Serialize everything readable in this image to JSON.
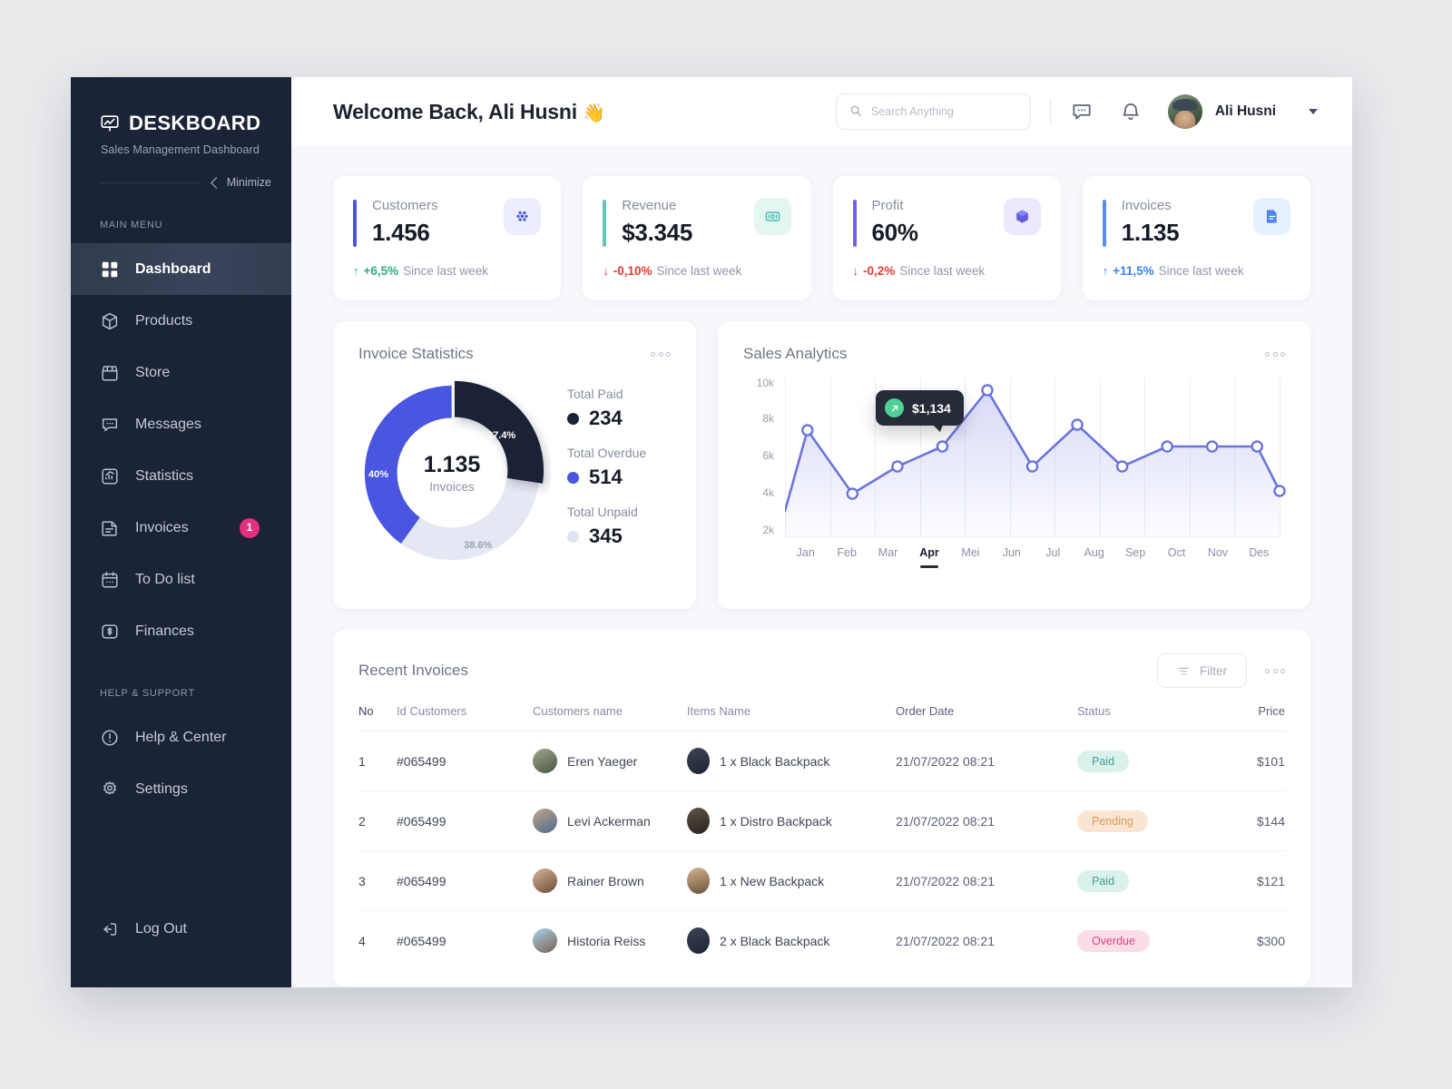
{
  "sidebar": {
    "brand": "DESKBOARD",
    "subtitle": "Sales Management Dashboard",
    "minimize_label": "Minimize",
    "main_menu_label": "MAIN MENU",
    "help_label": "HELP & SUPPORT",
    "items": [
      {
        "label": "Dashboard",
        "icon": "grid-icon",
        "active": true
      },
      {
        "label": "Products",
        "icon": "box-icon",
        "active": false
      },
      {
        "label": "Store",
        "icon": "store-icon",
        "active": false
      },
      {
        "label": "Messages",
        "icon": "chat-icon",
        "active": false
      },
      {
        "label": "Statistics",
        "icon": "chart-icon",
        "active": false
      },
      {
        "label": "Invoices",
        "icon": "invoice-icon",
        "active": false,
        "badge": "1"
      },
      {
        "label": "To Do list",
        "icon": "calendar-icon",
        "active": false
      },
      {
        "label": "Finances",
        "icon": "dollar-icon",
        "active": false
      }
    ],
    "help_items": [
      {
        "label": "Help & Center",
        "icon": "info-icon"
      },
      {
        "label": "Settings",
        "icon": "gear-icon"
      }
    ],
    "logout": {
      "label": "Log Out",
      "icon": "logout-icon"
    }
  },
  "header": {
    "welcome": "Welcome Back, Ali Husni",
    "wave_emoji": "👋",
    "search_placeholder": "Search Anything",
    "search_value": "",
    "user_name": "Ali Husni",
    "message_icon": "chat-bubble-icon",
    "bell_icon": "bell-icon"
  },
  "stats": [
    {
      "label": "Customers",
      "value": "1.456",
      "delta": "+6,5%",
      "since": "Since last week",
      "dir": "up",
      "delta_color": "#2bb07a",
      "accent": "#4a55e0",
      "icon": "users-icon",
      "icon_bg": "#eceefd",
      "icon_color": "#4a55e0"
    },
    {
      "label": "Revenue",
      "value": "$3.345",
      "delta": "-0,10%",
      "since": "Since last week",
      "dir": "down",
      "delta_color": "#e53935",
      "accent": "#66c6b5",
      "icon": "money-icon",
      "icon_bg": "#e4f5f2",
      "icon_color": "#4cbfae"
    },
    {
      "label": "Profit",
      "value": "60%",
      "delta": "-0,2%",
      "since": "Since last week",
      "dir": "down",
      "delta_color": "#e53935",
      "accent": "#6a63e8",
      "icon": "cube-icon",
      "icon_bg": "#ebeafc",
      "icon_color": "#5b52dd"
    },
    {
      "label": "Invoices",
      "value": "1.135",
      "delta": "+11,5%",
      "since": "Since last week",
      "dir": "up",
      "delta_color": "#3b82f6",
      "accent": "#5b8def",
      "icon": "document-icon",
      "icon_bg": "#e6effd",
      "icon_color": "#4b86ee"
    }
  ],
  "invoice_panel": {
    "title": "Invoice Statistics",
    "center_value": "1.135",
    "center_caption": "Invoices",
    "menu_icon": "more-dots-icon",
    "legend": [
      {
        "label": "Total Paid",
        "value": "234",
        "color": "#1b2436"
      },
      {
        "label": "Total Overdue",
        "value": "514",
        "color": "#4a55e0"
      },
      {
        "label": "Total Unpaid",
        "value": "345",
        "color": "#dfe4f0"
      }
    ]
  },
  "sales_panel": {
    "title": "Sales Analytics",
    "menu_icon": "more-dots-icon",
    "tooltip_value": "$1,134",
    "tooltip_icon": "arrow-up-right-icon",
    "active_month": "Apr"
  },
  "chart_data": [
    {
      "type": "pie",
      "title": "Invoice Statistics",
      "center_label": "1.135 Invoices",
      "labels": [
        "Total Paid",
        "Total Overdue",
        "Total Unpaid"
      ],
      "values": [
        234,
        514,
        345
      ],
      "percent_labels": [
        "27.4%",
        "40%",
        "38.6%"
      ],
      "colors": [
        "#1b2436",
        "#4a55e0",
        "#e4e8f2"
      ],
      "legend": "right"
    },
    {
      "type": "line",
      "title": "Sales Analytics",
      "x": [
        "Jan",
        "Feb",
        "Mar",
        "Apr",
        "Mei",
        "Jun",
        "Jul",
        "Aug",
        "Sep",
        "Oct",
        "Nov",
        "Des"
      ],
      "categories": [
        "Jan",
        "Feb",
        "Mar",
        "Apr",
        "Mei",
        "Jun",
        "Jul",
        "Aug",
        "Sep",
        "Oct",
        "Nov",
        "Des"
      ],
      "series": [
        {
          "name": "Sales",
          "values": [
            6300,
            4300,
            5300,
            6100,
            9500,
            5300,
            7000,
            5300,
            6100,
            6100,
            6100,
            3800
          ]
        }
      ],
      "ytick_labels": [
        "2k",
        "4k",
        "6k",
        "8k",
        "10k"
      ],
      "ytick_values": [
        2000,
        4000,
        6000,
        8000,
        10000
      ],
      "ylim": [
        1000,
        11000
      ],
      "xlabel": "",
      "ylabel": "",
      "grid": "vertical",
      "line_color": "#6b74dd",
      "annotation": {
        "label": "$1,134",
        "at_x": "Apr"
      },
      "legend": "none"
    }
  ],
  "table_panel": {
    "title": "Recent Invoices",
    "filter_label": "Filter",
    "filter_icon": "filter-icon",
    "menu_icon": "more-dots-icon",
    "columns": [
      "No",
      "Id Customers",
      "Customers name",
      "Items Name",
      "Order Date",
      "Status",
      "Price"
    ],
    "rows": [
      {
        "no": "1",
        "id": "#065499",
        "name": "Eren Yaeger",
        "item": "1 x Black Backpack",
        "date": "21/07/2022  08:21",
        "status": "Paid",
        "status_type": "paid",
        "price": "$101"
      },
      {
        "no": "2",
        "id": "#065499",
        "name": "Levi Ackerman",
        "item": "1 x Distro Backpack",
        "date": "21/07/2022  08:21",
        "status": "Pending",
        "status_type": "pending",
        "price": "$144"
      },
      {
        "no": "3",
        "id": "#065499",
        "name": "Rainer Brown",
        "item": "1 x New Backpack",
        "date": "21/07/2022  08:21",
        "status": "Paid",
        "status_type": "paid",
        "price": "$121"
      },
      {
        "no": "4",
        "id": "#065499",
        "name": "Historia Reiss",
        "item": "2 x Black Backpack",
        "date": "21/07/2022  08:21",
        "status": "Overdue",
        "status_type": "overdue",
        "price": "$300"
      }
    ]
  }
}
